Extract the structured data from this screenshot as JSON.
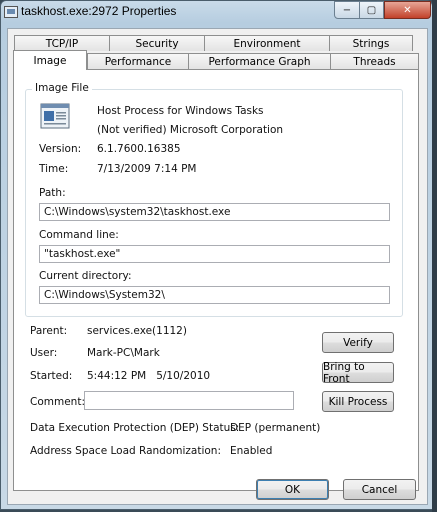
{
  "window": {
    "title": "taskhost.exe:2972 Properties"
  },
  "caption_buttons": {
    "minimize": "−",
    "maximize": "▢",
    "close": "✕"
  },
  "tabs_row1": [
    "TCP/IP",
    "Security",
    "Environment",
    "Strings"
  ],
  "tabs_row2": [
    "Image",
    "Performance",
    "Performance Graph",
    "Threads"
  ],
  "active_tab": "Image",
  "image_file": {
    "group_title": "Image File",
    "description": "Host Process for Windows Tasks",
    "company": "(Not verified) Microsoft Corporation",
    "version_label": "Version:",
    "version": "6.1.7600.16385",
    "time_label": "Time:",
    "time": "7/13/2009 7:14 PM",
    "path_label": "Path:",
    "path": "C:\\Windows\\system32\\taskhost.exe",
    "command_line_label": "Command line:",
    "command_line": "\"taskhost.exe\"",
    "current_directory_label": "Current directory:",
    "current_directory": "C:\\Windows\\System32\\"
  },
  "process": {
    "parent_label": "Parent:",
    "parent": "services.exe(1112)",
    "user_label": "User:",
    "user": "Mark-PC\\Mark",
    "started_label": "Started:",
    "started": "5:44:12 PM   5/10/2010",
    "comment_label": "Comment:",
    "comment": "",
    "dep_label": "Data Execution Protection (DEP) Status:",
    "dep": "DEP (permanent)",
    "aslr_label": "Address Space Load Randomization:",
    "aslr": "Enabled"
  },
  "buttons": {
    "verify": "Verify",
    "bring_to_front": "Bring to Front",
    "kill_process": "Kill Process",
    "ok": "OK",
    "cancel": "Cancel"
  },
  "colors": {
    "close_button": "#c2412a",
    "title_bar": "#b6cde0",
    "dialog_bg": "#f0f0f0"
  }
}
